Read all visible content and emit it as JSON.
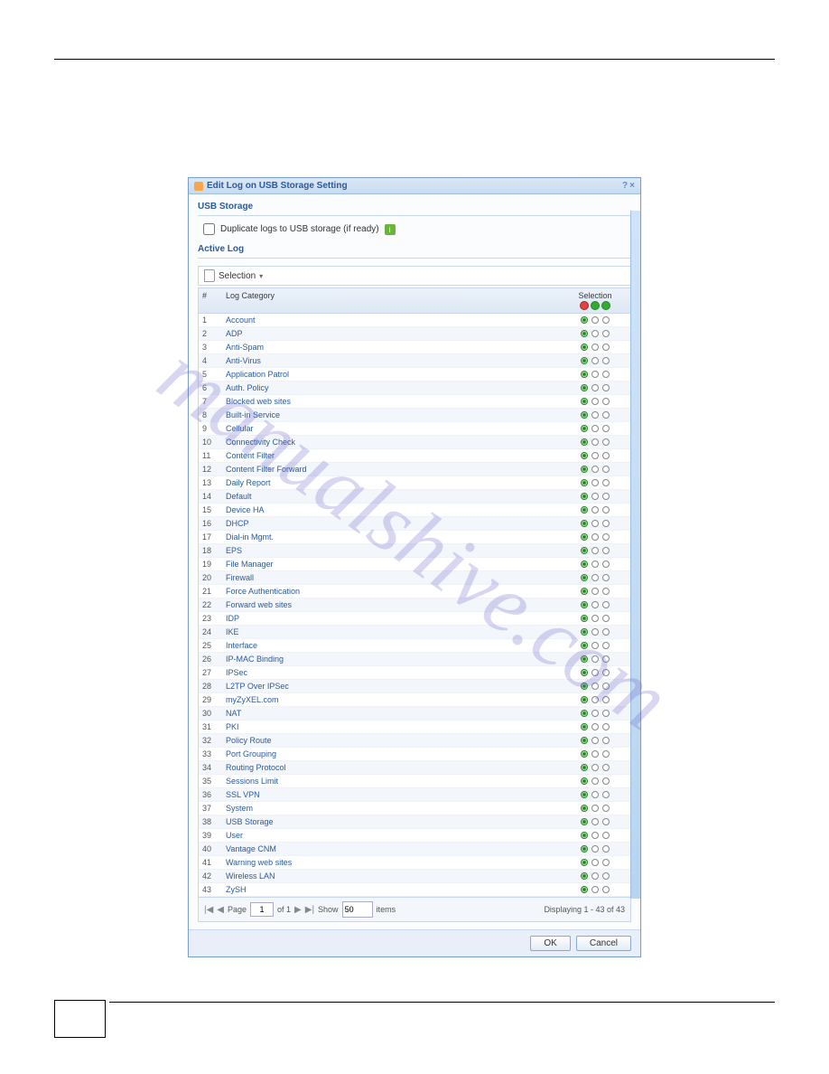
{
  "watermark": "manualshive.com",
  "dialog": {
    "title": "Edit Log on USB Storage Setting",
    "help_icon": "?",
    "close_icon": "×",
    "sections": {
      "usb_storage": "USB Storage",
      "active_log": "Active Log"
    },
    "checkbox_label": "Duplicate logs to USB storage (if ready)",
    "selection_label": "Selection",
    "selection_arrow": "▾",
    "columns": {
      "num": "#",
      "category": "Log Category",
      "selection": "Selection"
    },
    "rows": [
      {
        "n": "1",
        "cat": "Account"
      },
      {
        "n": "2",
        "cat": "ADP"
      },
      {
        "n": "3",
        "cat": "Anti-Spam"
      },
      {
        "n": "4",
        "cat": "Anti-Virus"
      },
      {
        "n": "5",
        "cat": "Application Patrol"
      },
      {
        "n": "6",
        "cat": "Auth. Policy"
      },
      {
        "n": "7",
        "cat": "Blocked web sites"
      },
      {
        "n": "8",
        "cat": "Built-in Service"
      },
      {
        "n": "9",
        "cat": "Cellular"
      },
      {
        "n": "10",
        "cat": "Connectivity Check"
      },
      {
        "n": "11",
        "cat": "Content Filter"
      },
      {
        "n": "12",
        "cat": "Content Filter Forward"
      },
      {
        "n": "13",
        "cat": "Daily Report"
      },
      {
        "n": "14",
        "cat": "Default"
      },
      {
        "n": "15",
        "cat": "Device HA"
      },
      {
        "n": "16",
        "cat": "DHCP"
      },
      {
        "n": "17",
        "cat": "Dial-in Mgmt."
      },
      {
        "n": "18",
        "cat": "EPS"
      },
      {
        "n": "19",
        "cat": "File Manager"
      },
      {
        "n": "20",
        "cat": "Firewall"
      },
      {
        "n": "21",
        "cat": "Force Authentication"
      },
      {
        "n": "22",
        "cat": "Forward web sites"
      },
      {
        "n": "23",
        "cat": "IDP"
      },
      {
        "n": "24",
        "cat": "IKE"
      },
      {
        "n": "25",
        "cat": "Interface"
      },
      {
        "n": "26",
        "cat": "IP-MAC Binding"
      },
      {
        "n": "27",
        "cat": "IPSec"
      },
      {
        "n": "28",
        "cat": "L2TP Over IPSec"
      },
      {
        "n": "29",
        "cat": "myZyXEL.com"
      },
      {
        "n": "30",
        "cat": "NAT"
      },
      {
        "n": "31",
        "cat": "PKI"
      },
      {
        "n": "32",
        "cat": "Policy Route"
      },
      {
        "n": "33",
        "cat": "Port Grouping"
      },
      {
        "n": "34",
        "cat": "Routing Protocol"
      },
      {
        "n": "35",
        "cat": "Sessions Limit"
      },
      {
        "n": "36",
        "cat": "SSL VPN"
      },
      {
        "n": "37",
        "cat": "System"
      },
      {
        "n": "38",
        "cat": "USB Storage"
      },
      {
        "n": "39",
        "cat": "User"
      },
      {
        "n": "40",
        "cat": "Vantage CNM"
      },
      {
        "n": "41",
        "cat": "Warning web sites"
      },
      {
        "n": "42",
        "cat": "Wireless LAN"
      },
      {
        "n": "43",
        "cat": "ZySH"
      }
    ],
    "pager": {
      "first": "|◀",
      "prev": "◀",
      "page_label": "Page",
      "page_value": "1",
      "of_label": "of 1",
      "next": "▶",
      "last": "▶|",
      "show_label": "Show",
      "show_value": "50",
      "items_label": "items",
      "displaying": "Displaying 1 - 43 of 43"
    },
    "buttons": {
      "ok": "OK",
      "cancel": "Cancel"
    }
  }
}
